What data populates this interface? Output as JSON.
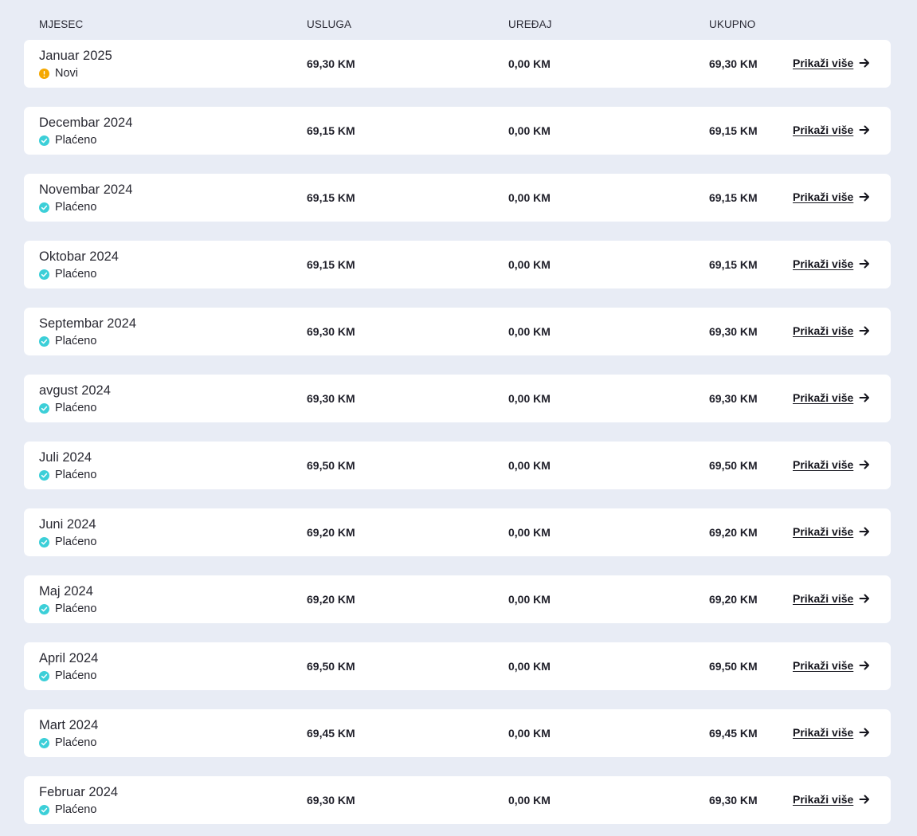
{
  "header": {
    "month": "MJESEC",
    "service": "USLUGA",
    "device": "UREĐAJ",
    "total": "UKUPNO"
  },
  "colors": {
    "background": "#e8ecf5",
    "row_background": "#ffffff",
    "status_new": "#f5a800",
    "status_paid": "#3ccfd8"
  },
  "rows": [
    {
      "month": "Januar 2025",
      "status": "Novi",
      "status_icon": "warning-icon",
      "service": "69,30 KM",
      "device": "0,00 KM",
      "total": "69,30 KM",
      "action": "Prikaži više"
    },
    {
      "month": "Decembar 2024",
      "status": "Plaćeno",
      "status_icon": "check-circle-icon",
      "service": "69,15 KM",
      "device": "0,00 KM",
      "total": "69,15 KM",
      "action": "Prikaži više"
    },
    {
      "month": "Novembar 2024",
      "status": "Plaćeno",
      "status_icon": "check-circle-icon",
      "service": "69,15 KM",
      "device": "0,00 KM",
      "total": "69,15 KM",
      "action": "Prikaži više"
    },
    {
      "month": "Oktobar 2024",
      "status": "Plaćeno",
      "status_icon": "check-circle-icon",
      "service": "69,15 KM",
      "device": "0,00 KM",
      "total": "69,15 KM",
      "action": "Prikaži više"
    },
    {
      "month": "Septembar 2024",
      "status": "Plaćeno",
      "status_icon": "check-circle-icon",
      "service": "69,30 KM",
      "device": "0,00 KM",
      "total": "69,30 KM",
      "action": "Prikaži više"
    },
    {
      "month": "avgust 2024",
      "status": "Plaćeno",
      "status_icon": "check-circle-icon",
      "service": "69,30 KM",
      "device": "0,00 KM",
      "total": "69,30 KM",
      "action": "Prikaži više"
    },
    {
      "month": "Juli 2024",
      "status": "Plaćeno",
      "status_icon": "check-circle-icon",
      "service": "69,50 KM",
      "device": "0,00 KM",
      "total": "69,50 KM",
      "action": "Prikaži više"
    },
    {
      "month": "Juni 2024",
      "status": "Plaćeno",
      "status_icon": "check-circle-icon",
      "service": "69,20 KM",
      "device": "0,00 KM",
      "total": "69,20 KM",
      "action": "Prikaži više"
    },
    {
      "month": "Maj 2024",
      "status": "Plaćeno",
      "status_icon": "check-circle-icon",
      "service": "69,20 KM",
      "device": "0,00 KM",
      "total": "69,20 KM",
      "action": "Prikaži više"
    },
    {
      "month": "April 2024",
      "status": "Plaćeno",
      "status_icon": "check-circle-icon",
      "service": "69,50 KM",
      "device": "0,00 KM",
      "total": "69,50 KM",
      "action": "Prikaži više"
    },
    {
      "month": "Mart 2024",
      "status": "Plaćeno",
      "status_icon": "check-circle-icon",
      "service": "69,45 KM",
      "device": "0,00 KM",
      "total": "69,45 KM",
      "action": "Prikaži više"
    },
    {
      "month": "Februar 2024",
      "status": "Plaćeno",
      "status_icon": "check-circle-icon",
      "service": "69,30 KM",
      "device": "0,00 KM",
      "total": "69,30 KM",
      "action": "Prikaži više"
    }
  ]
}
